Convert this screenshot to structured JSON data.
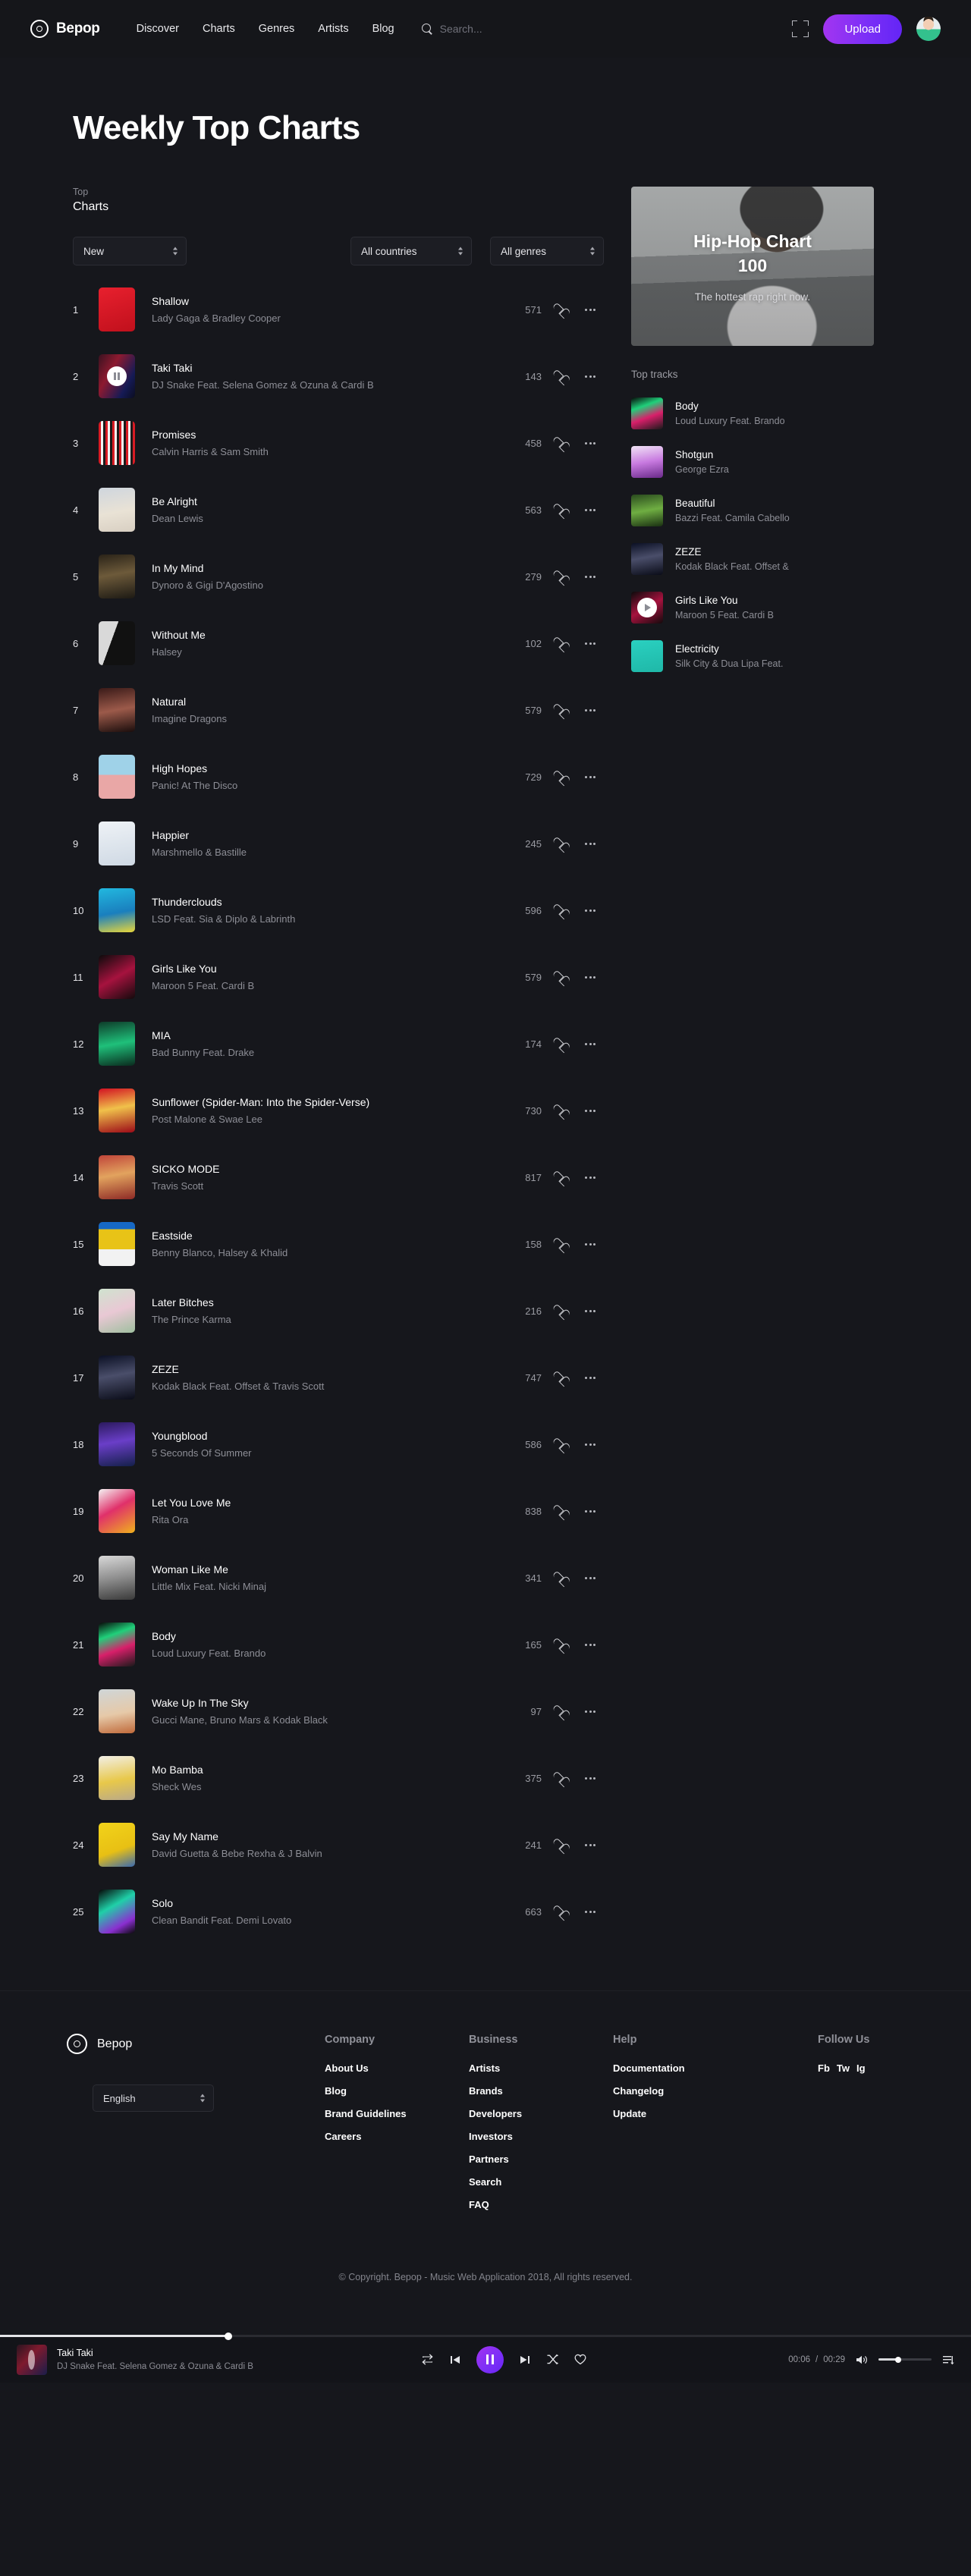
{
  "header": {
    "brand": "Bepop",
    "nav": [
      "Discover",
      "Charts",
      "Genres",
      "Artists",
      "Blog"
    ],
    "search_placeholder": "Search...",
    "search_value": "",
    "upload_label": "Upload"
  },
  "page": {
    "title": "Weekly Top Charts",
    "section_kicker": "Top",
    "section_heading": "Charts"
  },
  "filters": {
    "sort": "New",
    "country": "All countries",
    "genre": "All genres"
  },
  "hero": {
    "title_line1": "Hip-Hop Chart",
    "title_line2": "100",
    "subtitle": "The hottest rap right now."
  },
  "sidebar": {
    "heading": "Top tracks",
    "tracks": [
      {
        "title": "Body",
        "artist": "Loud Luxury Feat. Brando",
        "art": "body",
        "state": ""
      },
      {
        "title": "Shotgun",
        "artist": "George Ezra",
        "art": "shotgun",
        "state": ""
      },
      {
        "title": "Beautiful",
        "artist": "Bazzi Feat. Camila Cabello",
        "art": "beautiful",
        "state": ""
      },
      {
        "title": "ZEZE",
        "artist": "Kodak Black Feat. Offset &",
        "art": "zeze",
        "state": ""
      },
      {
        "title": "Girls Like You",
        "artist": "Maroon 5 Feat. Cardi B",
        "art": "girlslike",
        "state": "play"
      },
      {
        "title": "Electricity",
        "artist": "Silk City & Dua Lipa Feat.",
        "art": "electricity",
        "state": ""
      }
    ]
  },
  "tracks": [
    {
      "rank": "1",
      "title": "Shallow",
      "artist": "Lady Gaga & Bradley Cooper",
      "count": "571",
      "art": "shallow",
      "state": ""
    },
    {
      "rank": "2",
      "title": "Taki Taki",
      "artist": "DJ Snake Feat. Selena Gomez & Ozuna & Cardi B",
      "count": "143",
      "art": "takitaki",
      "state": "pause"
    },
    {
      "rank": "3",
      "title": "Promises",
      "artist": "Calvin Harris & Sam Smith",
      "count": "458",
      "art": "promises",
      "state": ""
    },
    {
      "rank": "4",
      "title": "Be Alright",
      "artist": "Dean Lewis",
      "count": "563",
      "art": "bealright",
      "state": ""
    },
    {
      "rank": "5",
      "title": "In My Mind",
      "artist": "Dynoro & Gigi D'Agostino",
      "count": "279",
      "art": "inmymind",
      "state": ""
    },
    {
      "rank": "6",
      "title": "Without Me",
      "artist": "Halsey",
      "count": "102",
      "art": "withoutme",
      "state": ""
    },
    {
      "rank": "7",
      "title": "Natural",
      "artist": "Imagine Dragons",
      "count": "579",
      "art": "natural",
      "state": ""
    },
    {
      "rank": "8",
      "title": "High Hopes",
      "artist": "Panic! At The Disco",
      "count": "729",
      "art": "highhopes",
      "state": ""
    },
    {
      "rank": "9",
      "title": "Happier",
      "artist": "Marshmello & Bastille",
      "count": "245",
      "art": "happier",
      "state": ""
    },
    {
      "rank": "10",
      "title": "Thunderclouds",
      "artist": "LSD Feat. Sia & Diplo & Labrinth",
      "count": "596",
      "art": "thunderclouds",
      "state": ""
    },
    {
      "rank": "11",
      "title": "Girls Like You",
      "artist": "Maroon 5 Feat. Cardi B",
      "count": "579",
      "art": "girlslike",
      "state": ""
    },
    {
      "rank": "12",
      "title": "MIA",
      "artist": "Bad Bunny Feat. Drake",
      "count": "174",
      "art": "mia",
      "state": ""
    },
    {
      "rank": "13",
      "title": "Sunflower (Spider-Man: Into the Spider-Verse)",
      "artist": "Post Malone & Swae Lee",
      "count": "730",
      "art": "sunflower",
      "state": ""
    },
    {
      "rank": "14",
      "title": "SICKO MODE",
      "artist": "Travis Scott",
      "count": "817",
      "art": "sickomode",
      "state": ""
    },
    {
      "rank": "15",
      "title": "Eastside",
      "artist": "Benny Blanco, Halsey & Khalid",
      "count": "158",
      "art": "eastside",
      "state": ""
    },
    {
      "rank": "16",
      "title": "Later Bitches",
      "artist": "The Prince Karma",
      "count": "216",
      "art": "laterbitches",
      "state": ""
    },
    {
      "rank": "17",
      "title": "ZEZE",
      "artist": "Kodak Black Feat. Offset & Travis Scott",
      "count": "747",
      "art": "zeze",
      "state": ""
    },
    {
      "rank": "18",
      "title": "Youngblood",
      "artist": "5 Seconds Of Summer",
      "count": "586",
      "art": "youngblood",
      "state": ""
    },
    {
      "rank": "19",
      "title": "Let You Love Me",
      "artist": "Rita Ora",
      "count": "838",
      "art": "letyoulove",
      "state": ""
    },
    {
      "rank": "20",
      "title": "Woman Like Me",
      "artist": "Little Mix Feat. Nicki Minaj",
      "count": "341",
      "art": "womanlikeme",
      "state": ""
    },
    {
      "rank": "21",
      "title": "Body",
      "artist": "Loud Luxury Feat. Brando",
      "count": "165",
      "art": "body",
      "state": ""
    },
    {
      "rank": "22",
      "title": "Wake Up In The Sky",
      "artist": "Gucci Mane, Bruno Mars & Kodak Black",
      "count": "97",
      "art": "wakeup",
      "state": ""
    },
    {
      "rank": "23",
      "title": "Mo Bamba",
      "artist": "Sheck Wes",
      "count": "375",
      "art": "mobamba",
      "state": ""
    },
    {
      "rank": "24",
      "title": "Say My Name",
      "artist": "David Guetta & Bebe Rexha & J Balvin",
      "count": "241",
      "art": "saymyname",
      "state": ""
    },
    {
      "rank": "25",
      "title": "Solo",
      "artist": "Clean Bandit Feat. Demi Lovato",
      "count": "663",
      "art": "solo",
      "state": ""
    }
  ],
  "footer": {
    "brand": "Bepop",
    "language": "English",
    "columns": [
      {
        "title": "Company",
        "links": [
          "About Us",
          "Blog",
          "Brand Guidelines",
          "Careers"
        ]
      },
      {
        "title": "Business",
        "links": [
          "Artists",
          "Brands",
          "Developers",
          "Investors",
          "Partners",
          "Search",
          "FAQ"
        ]
      },
      {
        "title": "Help",
        "links": [
          "Documentation",
          "Changelog",
          "Update"
        ]
      }
    ],
    "follow_title": "Follow Us",
    "social": [
      "Fb",
      "Tw",
      "Ig"
    ],
    "copyright": "© Copyright. Bepop - Music Web Application 2018, All rights reserved."
  },
  "player": {
    "title": "Taki Taki",
    "artist": "DJ Snake Feat. Selena Gomez & Ozuna & Cardi B",
    "current_time": "00:06",
    "separator": "/",
    "total_time": "00:29"
  },
  "colors": {
    "accent": "#7b2ff7",
    "background": "#16171c",
    "panel": "#1c1d23"
  }
}
